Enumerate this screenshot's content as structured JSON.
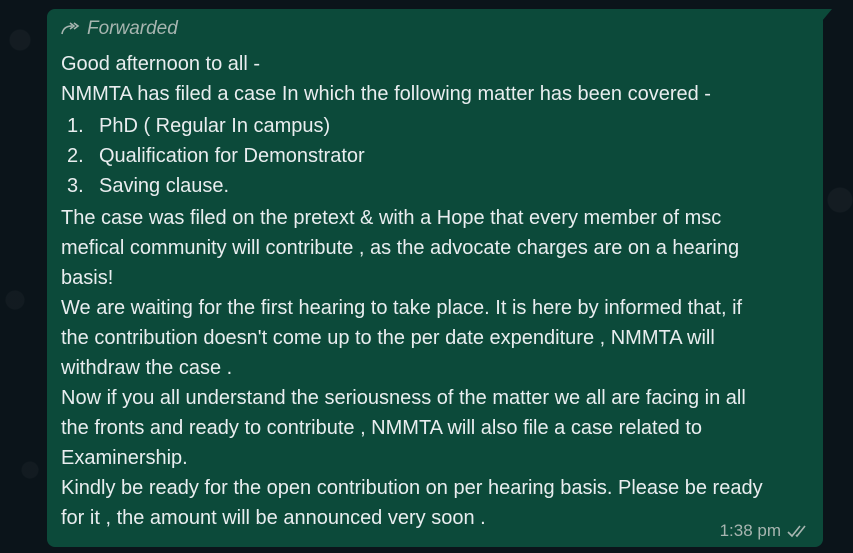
{
  "message": {
    "forwarded_label": "Forwarded",
    "greeting": "Good afternoon to all -",
    "intro": "NMMTA has filed a case In which the following matter has been covered -",
    "list": [
      {
        "num": "1.",
        "text": "PhD ( Regular In campus)"
      },
      {
        "num": "2.",
        "text": "Qualification for Demonstrator"
      },
      {
        "num": "3.",
        "text": "Saving clause."
      }
    ],
    "body_lines": [
      "The case was filed on the pretext & with a Hope that every  member of msc",
      "mefical community will  contribute , as the advocate charges are on a hearing",
      "basis!",
      "We are waiting for the first hearing to take place. It is here by informed that, if",
      "the contribution doesn't come up to the per date  expenditure , NMMTA will",
      "withdraw the case .",
      "Now if you all understand the seriousness of the matter we all are facing in all",
      "the fronts and ready to contribute  , NMMTA will also file a case related to",
      "Examinership.",
      "Kindly be ready for the open contribution on per hearing basis. Please be ready",
      "for it , the amount will be announced very soon ."
    ],
    "time": "1:38 pm",
    "status_icon": "double-check-icon"
  },
  "colors": {
    "bubble": "#0c4a3a",
    "background": "#0b141a",
    "text": "#e9edef",
    "meta": "#a7b5b0"
  }
}
